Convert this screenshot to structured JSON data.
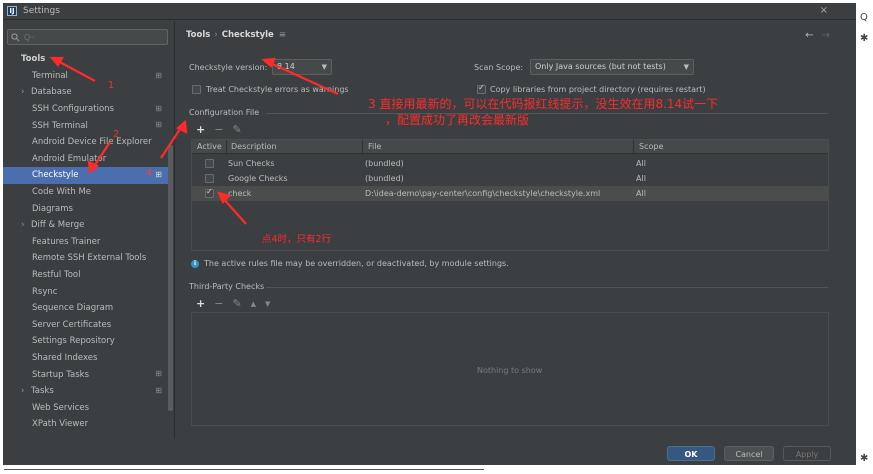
{
  "window": {
    "title": "Settings",
    "close_glyph": "×",
    "app_icon_label": "IJ"
  },
  "search": {
    "placeholder": "Q~",
    "value": ""
  },
  "sidebar": {
    "section": "Tools",
    "items": [
      {
        "label": "Terminal",
        "marker": "⊞"
      },
      {
        "label": "Database",
        "expandable": true
      },
      {
        "label": "SSH Configurations",
        "marker": "⊞"
      },
      {
        "label": "SSH Terminal",
        "marker": "⊞"
      },
      {
        "label": "Android Device File Explorer"
      },
      {
        "label": "Android Emulator"
      },
      {
        "label": "Checkstyle",
        "marker": "⊞",
        "selected": true
      },
      {
        "label": "Code With Me"
      },
      {
        "label": "Diagrams"
      },
      {
        "label": "Diff & Merge",
        "expandable": true
      },
      {
        "label": "Features Trainer"
      },
      {
        "label": "Remote SSH External Tools"
      },
      {
        "label": "Restful Tool"
      },
      {
        "label": "Rsync"
      },
      {
        "label": "Sequence Diagram"
      },
      {
        "label": "Server Certificates"
      },
      {
        "label": "Settings Repository"
      },
      {
        "label": "Shared Indexes"
      },
      {
        "label": "Startup Tasks",
        "marker": "⊞"
      },
      {
        "label": "Tasks",
        "expandable": true,
        "marker": "⊞"
      },
      {
        "label": "Web Services"
      },
      {
        "label": "XPath Viewer"
      }
    ]
  },
  "breadcrumb": {
    "parent": "Tools",
    "separator": "›",
    "current": "Checkstyle",
    "edit_glyph": "≡"
  },
  "nav": {
    "back": "←",
    "forward": "→"
  },
  "checkstyle": {
    "version_label": "Checkstyle version:",
    "version_value": "8.14",
    "scan_scope_label": "Scan Scope:",
    "scan_scope_value": "Only Java sources (but not tests)",
    "treat_errors_label": "Treat Checkstyle errors as warnings",
    "treat_errors_checked": false,
    "copy_libs_label": "Copy libraries from project directory (requires restart)",
    "copy_libs_checked": true
  },
  "config": {
    "title": "Configuration File",
    "toolbar": {
      "add": "+",
      "remove": "−",
      "edit": "✎"
    },
    "columns": [
      "Active",
      "Description",
      "File",
      "Scope"
    ],
    "rows": [
      {
        "active": false,
        "description": "Sun Checks",
        "file": "(bundled)",
        "scope": "All"
      },
      {
        "active": false,
        "description": "Google Checks",
        "file": "(bundled)",
        "scope": "All"
      },
      {
        "active": true,
        "description": "check",
        "file": "D:\\idea-demo\\pay-center\\config\\checkstyle\\checkstyle.xml",
        "scope": "All"
      }
    ]
  },
  "info_text": "The active rules file may be overridden, or deactivated, by module settings.",
  "third_party": {
    "title": "Third-Party Checks",
    "toolbar": {
      "add": "+",
      "remove": "−",
      "edit": "✎",
      "up": "▲",
      "down": "▼"
    },
    "empty_text": "Nothing to show"
  },
  "footer": {
    "help": "?",
    "ok": "OK",
    "cancel": "Cancel",
    "apply": "Apply"
  },
  "annotations": {
    "n1": "1",
    "n2": "2",
    "n3_line1": "3  直接用最新的，可以在代码报红线提示，没生效在用8.14试一下",
    "n3_line2": "，配置成功了再改会最新版",
    "n4": "4",
    "note_rows": "点4时，只有2行",
    "color": "#ff2a2a"
  },
  "outer": {
    "search_glyph": "Q",
    "gear_glyph": "✱"
  }
}
